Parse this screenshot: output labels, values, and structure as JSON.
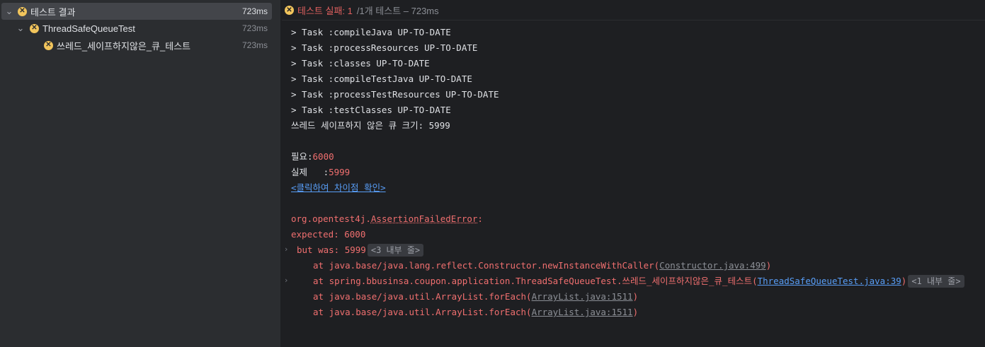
{
  "tree": {
    "items": [
      {
        "label": "테스트 결과",
        "time": "723ms"
      },
      {
        "label": "ThreadSafeQueueTest",
        "time": "723ms"
      },
      {
        "label": "쓰레드_세이프하지않은_큐_테스트",
        "time": "723ms"
      }
    ]
  },
  "status": {
    "fail_text": "테스트 실패: 1",
    "meta": "/1개 테스트 – 723ms"
  },
  "console": {
    "tasks": [
      "> Task :compileJava UP-TO-DATE",
      "> Task :processResources UP-TO-DATE",
      "> Task :classes UP-TO-DATE",
      "> Task :compileTestJava UP-TO-DATE",
      "> Task :processTestResources UP-TO-DATE",
      "> Task :testClasses UP-TO-DATE"
    ],
    "queue_size": "쓰레드 세이프하지 않은 큐 크기: 5999",
    "expected_label": "필요:",
    "expected_value": "6000",
    "actual_label": "실제   :",
    "actual_value": "5999",
    "diff_link": "<클릭하여 차이점 확인>",
    "error_prefix": "org.opentest4j.",
    "error_class": "AssertionFailedError",
    "error_suffix": ":",
    "expected_line": "expected: 6000",
    "but_was": "but was: 5999",
    "internal_3": "<3 내부 줄>",
    "trace1_prefix": "at java.base/java.lang.reflect.Constructor.newInstanceWithCaller(",
    "trace1_link": "Constructor.java:499",
    "trace1_suffix": ")",
    "trace2_prefix": "at spring.bbusinsa.coupon.application.ThreadSafeQueueTest.쓰레드_세이프하지않은_큐_테스트(",
    "trace2_link": "ThreadSafeQueueTest.java:39",
    "trace2_suffix": ")",
    "internal_1": "<1 내부 줄>",
    "trace3_prefix": "at java.base/java.util.ArrayList.forEach(",
    "trace3_link": "ArrayList.java:1511",
    "trace3_suffix": ")",
    "trace4_prefix": "at java.base/java.util.ArrayList.forEach(",
    "trace4_link": "ArrayList.java:1511",
    "trace4_suffix": ")"
  }
}
